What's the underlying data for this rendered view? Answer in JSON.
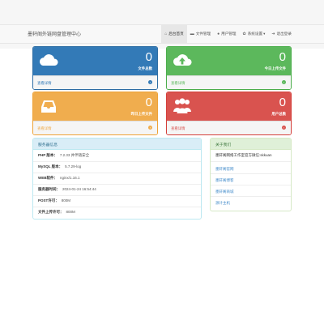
{
  "header": {
    "brand": "墨轩阁外链网盘管理中心",
    "nav": [
      {
        "label": "后台首页",
        "icon": "home-icon",
        "active": true
      },
      {
        "label": "文件管理",
        "icon": "folder-icon"
      },
      {
        "label": "用户管理",
        "icon": "users-icon"
      },
      {
        "label": "系统设置",
        "icon": "gear-icon",
        "caret": "▾"
      },
      {
        "label": "退出登录",
        "icon": "logout-icon"
      }
    ]
  },
  "cards": [
    {
      "value": "0",
      "label": "文件总数",
      "link": "查看详情",
      "color": "#337ab7",
      "icon": "cloud-icon"
    },
    {
      "value": "0",
      "label": "今日上传文件",
      "link": "查看详情",
      "color": "#5cb85c",
      "icon": "cloud-upload-icon"
    },
    {
      "value": "0",
      "label": "昨日上传文件",
      "link": "查看详情",
      "color": "#f0ad4e",
      "icon": "inbox-icon"
    },
    {
      "value": "0",
      "label": "用户总数",
      "link": "查看详情",
      "color": "#d9534f",
      "icon": "users-icon"
    }
  ],
  "server_info": {
    "title": "服务器信息",
    "rows": [
      {
        "key": "PHP 版本：",
        "value": "7.2.33 并伴随安全"
      },
      {
        "key": "MySQL 版本：",
        "value": "5.7.29-log"
      },
      {
        "key": "WEB软件：",
        "value": "nginx/1.16.1"
      },
      {
        "key": "服务器时间：",
        "value": "2024-01-24 16:54:44"
      },
      {
        "key": "POST许可：",
        "value": "800M"
      },
      {
        "key": "文件上传许可：",
        "value": "800M"
      }
    ]
  },
  "about": {
    "title": "关于我们",
    "text": "墨轩阁网络工作室官方微信:skkuan",
    "links": [
      "墨轩阁官网",
      "墨轩阁博客",
      "墨轩阁商城",
      "源计主机"
    ]
  }
}
